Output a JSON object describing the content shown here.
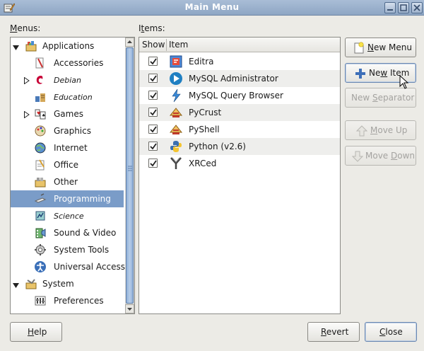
{
  "window": {
    "title": "Main Menu"
  },
  "labels": {
    "menus": "Menus:",
    "menus_mnemonic": "M",
    "menus_rest": "enus:",
    "items": "Items:",
    "items_prefix": "I",
    "items_mnemonic": "t",
    "items_rest": "ems:"
  },
  "menus_tree": [
    {
      "label": "Applications",
      "icon": "applications-icon",
      "level": 0,
      "expanded": true
    },
    {
      "label": "Accessories",
      "icon": "accessories-icon",
      "level": 1
    },
    {
      "label": "Debian",
      "icon": "debian-icon",
      "level": 1,
      "italic": true,
      "collapsed": true
    },
    {
      "label": "Education",
      "icon": "education-icon",
      "level": 1,
      "italic": true
    },
    {
      "label": "Games",
      "icon": "games-icon",
      "level": 1,
      "collapsed": true
    },
    {
      "label": "Graphics",
      "icon": "graphics-icon",
      "level": 1
    },
    {
      "label": "Internet",
      "icon": "internet-icon",
      "level": 1
    },
    {
      "label": "Office",
      "icon": "office-icon",
      "level": 1
    },
    {
      "label": "Other",
      "icon": "other-icon",
      "level": 1
    },
    {
      "label": "Programming",
      "icon": "programming-icon",
      "level": 1,
      "selected": true
    },
    {
      "label": "Science",
      "icon": "science-icon",
      "level": 1,
      "italic": true
    },
    {
      "label": "Sound & Video",
      "icon": "sound-video-icon",
      "level": 1
    },
    {
      "label": "System Tools",
      "icon": "system-tools-icon",
      "level": 1
    },
    {
      "label": "Universal Access",
      "icon": "universal-access-icon",
      "level": 1
    },
    {
      "label": "System",
      "icon": "system-icon",
      "level": 0,
      "expanded": true
    },
    {
      "label": "Preferences",
      "icon": "preferences-icon",
      "level": 1
    }
  ],
  "items_table": {
    "columns": [
      "Show",
      "Item"
    ],
    "rows": [
      {
        "name": "Editra",
        "checked": true,
        "icon": "editra-icon"
      },
      {
        "name": "MySQL Administrator",
        "checked": true,
        "icon": "mysql-administrator-icon"
      },
      {
        "name": "MySQL Query Browser",
        "checked": true,
        "icon": "mysql-query-browser-icon"
      },
      {
        "name": "PyCrust",
        "checked": true,
        "icon": "pycrust-icon"
      },
      {
        "name": "PyShell",
        "checked": true,
        "icon": "pyshell-icon"
      },
      {
        "name": "Python (v2.6)",
        "checked": true,
        "icon": "python-icon"
      },
      {
        "name": "XRCed",
        "checked": true,
        "icon": "xrced-icon"
      }
    ]
  },
  "buttons": {
    "new_menu": {
      "label": "New Menu",
      "mnemonic": "N",
      "rest": "ew Menu",
      "icon": "new-menu-icon"
    },
    "new_item": {
      "label": "New Item",
      "prefix": "Ne",
      "mnemonic": "w",
      "rest": " Item",
      "icon": "new-item-icon"
    },
    "new_separator": {
      "label": "New Separator",
      "prefix": "New ",
      "mnemonic": "S",
      "rest": "eparator",
      "disabled": true
    },
    "move_up": {
      "label": "Move Up",
      "mnemonic": "M",
      "rest": "ove Up",
      "icon": "move-up-icon",
      "disabled": true
    },
    "move_down": {
      "label": "Move Down",
      "prefix": "Move ",
      "mnemonic": "D",
      "rest": "own",
      "icon": "move-down-icon",
      "disabled": true
    },
    "help": {
      "label": "Help",
      "mnemonic": "H",
      "rest": "elp"
    },
    "revert": {
      "label": "Revert",
      "mnemonic": "R",
      "rest": "evert"
    },
    "close": {
      "label": "Close",
      "mnemonic": "C",
      "rest": "lose"
    }
  },
  "colors": {
    "selection": "#7a9cc8",
    "titlebar": "#8ea6c4"
  }
}
